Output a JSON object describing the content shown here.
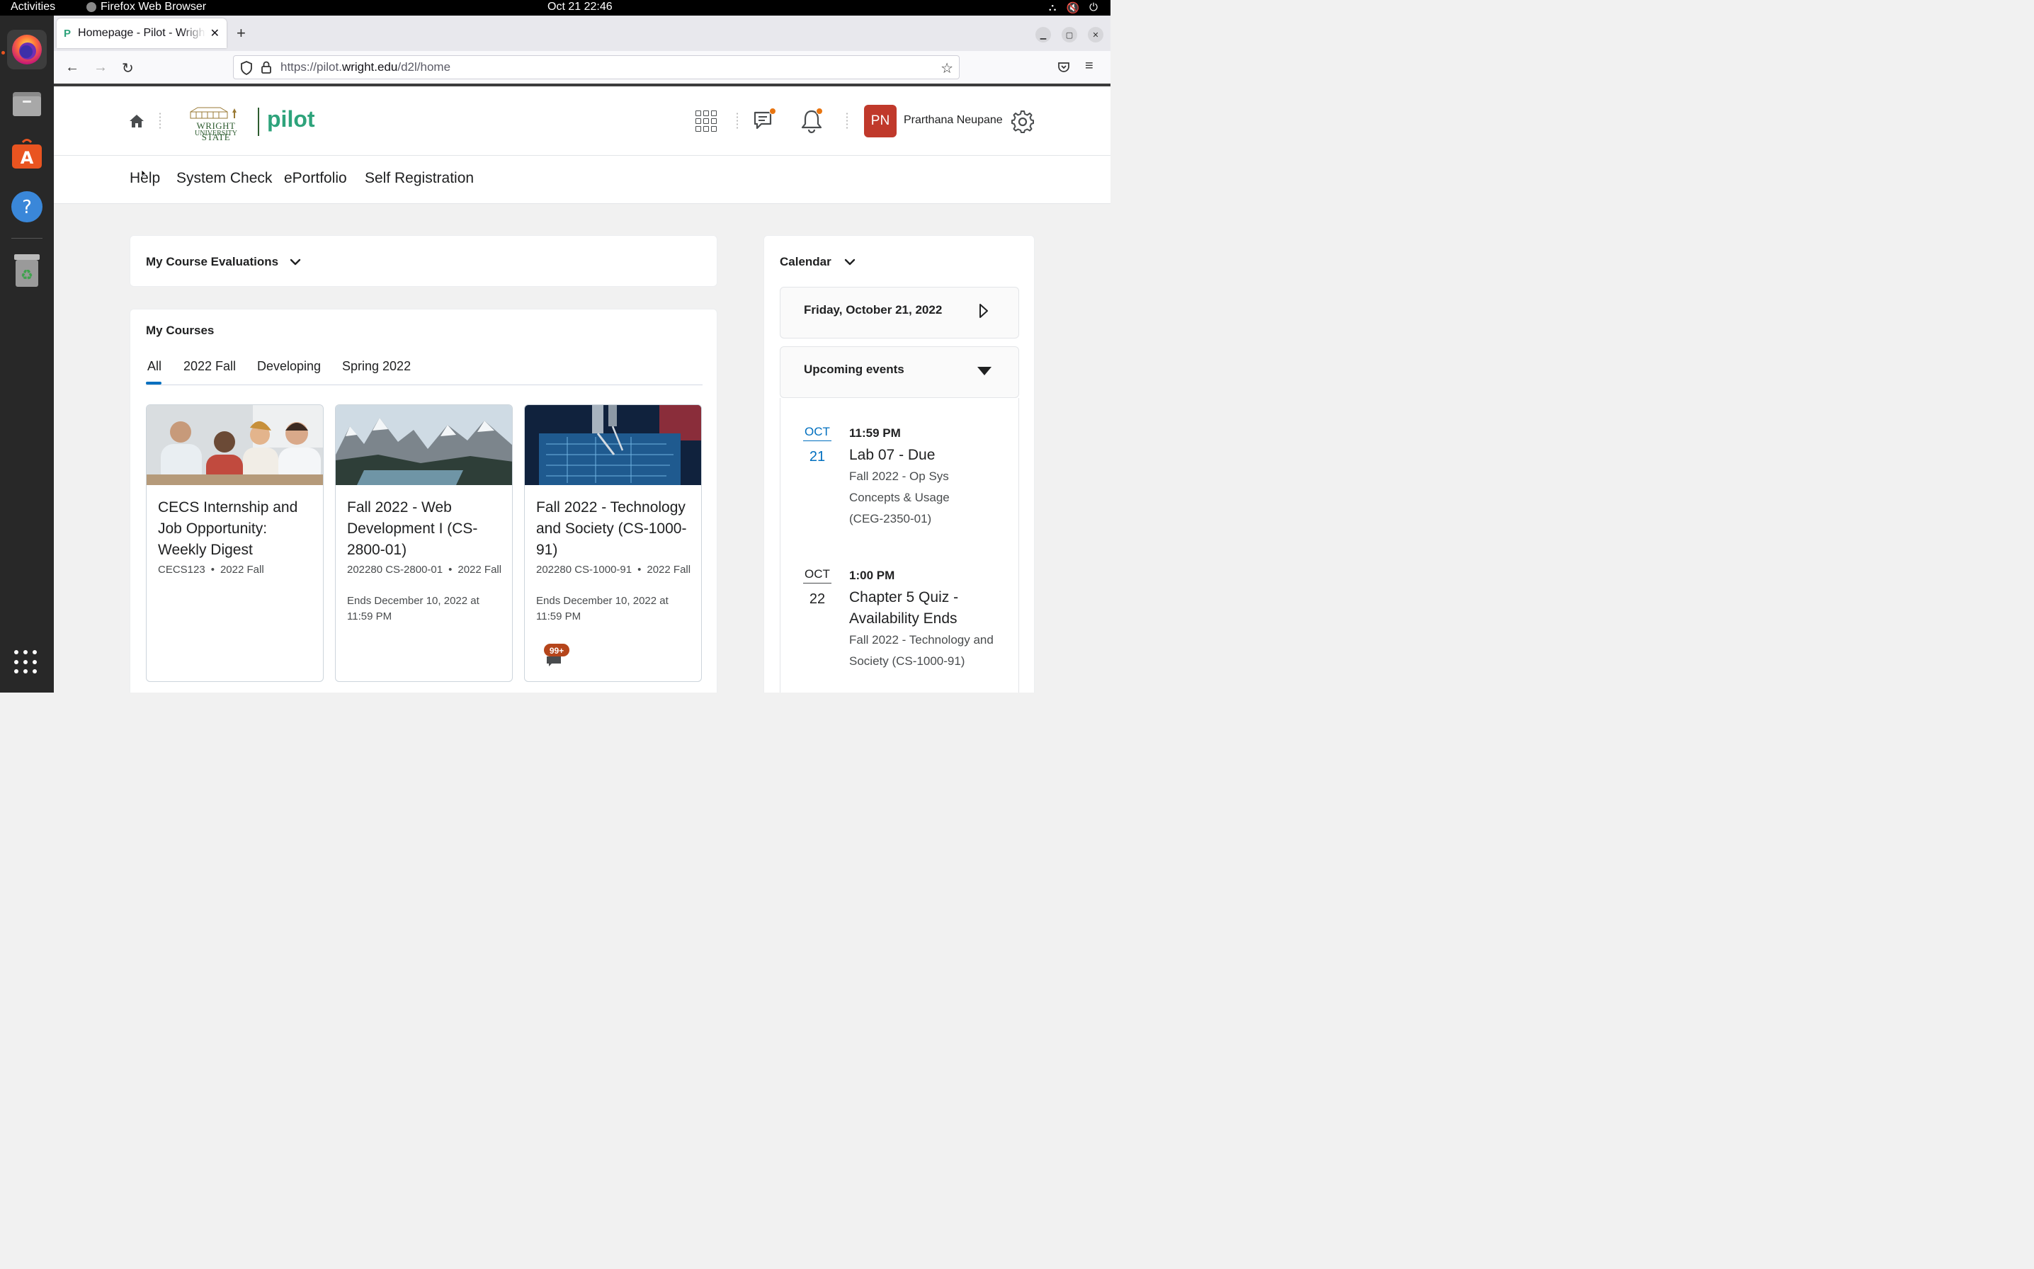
{
  "os": {
    "activities": "Activities",
    "app_name": "Firefox Web Browser",
    "clock": "Oct 21  22:46"
  },
  "browser": {
    "tab_title": "Homepage - Pilot - Wright State University",
    "tab_favicon": "P",
    "url_host_prefix": "https://pilot.",
    "url_host_main": "wright.edu",
    "url_path": "/d2l/home"
  },
  "header": {
    "logo_line1": "WRIGHT STATE",
    "logo_line2": "UNIVERSITY",
    "brand": "pilot",
    "avatar_initials": "PN",
    "user_name": "Prarthana Neupane"
  },
  "nav": {
    "links": [
      "Help",
      "System Check",
      "ePortfolio",
      "Self Registration"
    ]
  },
  "evaluations": {
    "title": "My Course Evaluations"
  },
  "courses": {
    "title": "My Courses",
    "tabs": [
      "All",
      "2022 Fall",
      "Developing",
      "Spring 2022"
    ],
    "active_tab": "All",
    "items": [
      {
        "title": "CECS Internship and Job Opportunity: Weekly Digest",
        "code": "CECS123",
        "term": "2022 Fall",
        "ends": ""
      },
      {
        "title": "Fall 2022 - Web Development I (CS-2800-01)",
        "code": "202280 CS-2800-01",
        "term": "2022 Fall",
        "ends": "Ends December 10, 2022 at 11:59 PM"
      },
      {
        "title": "Fall 2022 - Technology and Society (CS-1000-91)",
        "code": "202280 CS-1000-91",
        "term": "2022 Fall",
        "ends": "Ends December 10, 2022 at 11:59 PM",
        "badge": "99+"
      }
    ]
  },
  "calendar": {
    "title": "Calendar",
    "date": "Friday, October 21, 2022",
    "upcoming_label": "Upcoming events",
    "events": [
      {
        "month": "OCT",
        "day": "21",
        "time": "11:59 PM",
        "title": "Lab 07 - Due",
        "course": "Fall 2022 - Op Sys Concepts & Usage (CEG-2350-01)"
      },
      {
        "month": "OCT",
        "day": "22",
        "time": "1:00 PM",
        "title": "Chapter 5 Quiz - Availability Ends",
        "course": "Fall 2022 - Technology and Society (CS-1000-91)"
      }
    ]
  },
  "colors": {
    "brand_green": "#2ea37b",
    "wsu_green": "#2d5c2f",
    "avatar_red": "#c0392b",
    "notification_orange": "#e87511",
    "link_blue": "#006fbf",
    "badge_brown": "#b5451b"
  },
  "icons": [
    "home-icon",
    "apps-grid-icon",
    "chat-icon",
    "bell-icon",
    "gear-icon",
    "chevron-down-icon",
    "chevron-right-icon",
    "caret-down-icon",
    "discussion-icon"
  ]
}
